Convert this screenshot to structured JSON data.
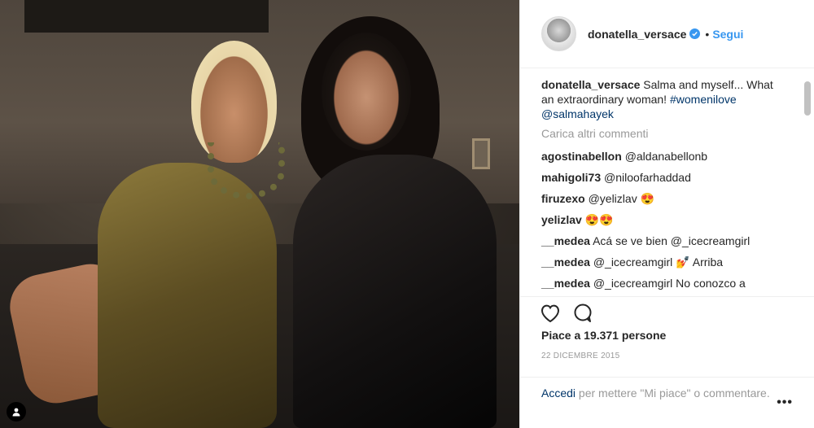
{
  "post": {
    "username": "donatella_versace",
    "verified": true,
    "separator": "•",
    "follow_label": "Segui",
    "caption": {
      "username": "donatella_versace",
      "text": "Salma and myself... What an extraordinary woman!",
      "hashtag": "#womenilove",
      "mention": "@salmahayek"
    },
    "load_more": "Carica altri commenti",
    "comments": [
      {
        "username": "agostinabellon",
        "text": "@aldanabellonb"
      },
      {
        "username": "mahigoli73",
        "text": "@niloofarhaddad"
      },
      {
        "username": "firuzexo",
        "text": "@yelizlav 😍"
      },
      {
        "username": "yelizlav",
        "text": "😍😍"
      },
      {
        "username": "__medea",
        "text": "Acá se ve bien @_icecreamgirl"
      },
      {
        "username": "__medea",
        "text": "@_icecreamgirl 💅 Arriba"
      },
      {
        "username": "__medea",
        "text": "@_icecreamgirl No conozco a"
      }
    ],
    "likes": "Piace a 19.371 persone",
    "date": "22 DICEMBRE 2015",
    "footer": {
      "login": "Accedi",
      "text": " per mettere \"Mi piace\" o commentare."
    },
    "more_label": "•••"
  },
  "icons": {
    "like": "heart-icon",
    "comment": "comment-icon",
    "verified": "verified-badge-icon",
    "photo_badge": "user-tag-icon"
  },
  "colors": {
    "accent": "#3897f0",
    "link": "#003569",
    "muted": "#999999",
    "text": "#262626"
  }
}
